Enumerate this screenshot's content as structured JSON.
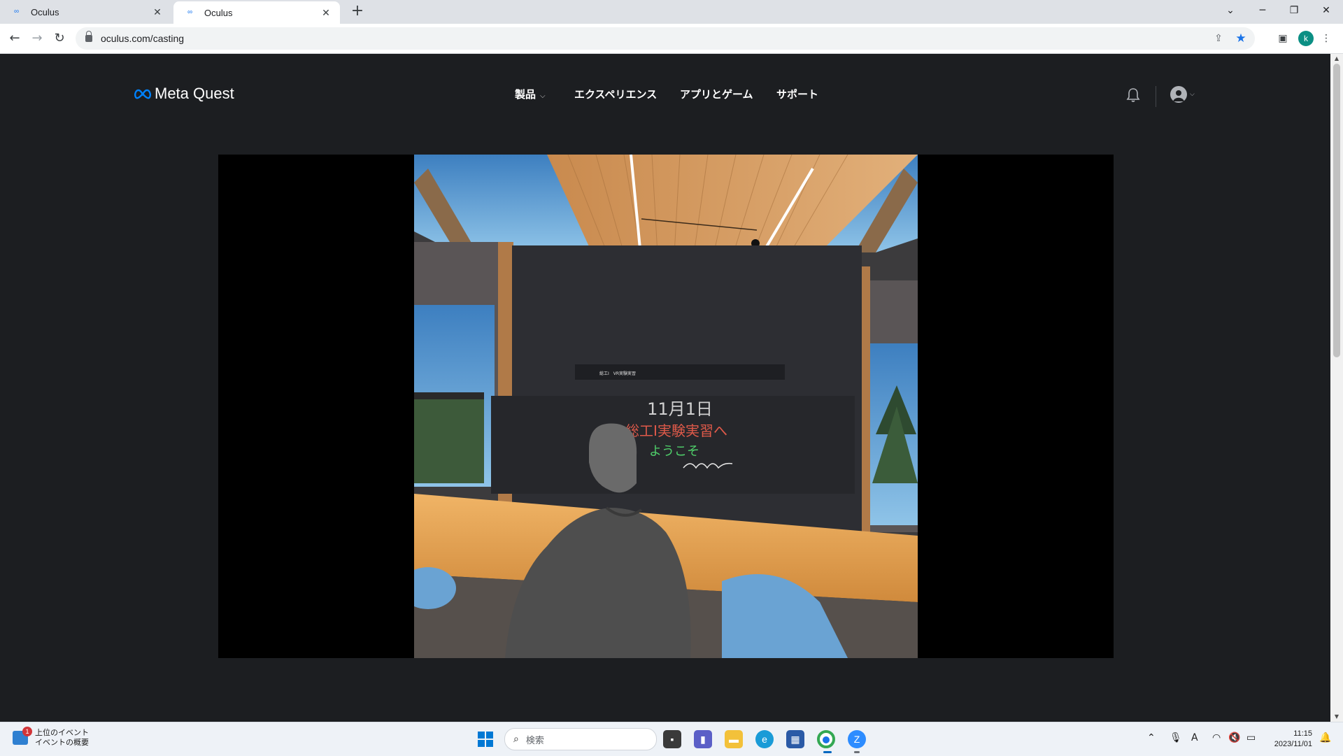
{
  "browser": {
    "tabs": [
      {
        "title": "Oculus",
        "favicon": "meta-icon",
        "active": false
      },
      {
        "title": "Oculus",
        "favicon": "meta-icon",
        "active": true
      }
    ],
    "new_tab": "+",
    "url": "oculus.com/casting",
    "profile_initial": "k"
  },
  "site": {
    "logo_text": "Meta Quest",
    "nav": [
      {
        "label": "製品",
        "has_dropdown": true
      },
      {
        "label": "エクスペリエンス",
        "has_dropdown": false
      },
      {
        "label": "アプリとゲーム",
        "has_dropdown": false
      },
      {
        "label": "サポート",
        "has_dropdown": false
      }
    ],
    "accent_color": "#0081fb",
    "page_bg": "#1c1e21"
  },
  "casting": {
    "board_title": "総工Ⅰ　VR実験実習",
    "board_lines": [
      "11月1日",
      "総工Ⅰ実験実習へ",
      "ようこそ"
    ]
  },
  "taskbar": {
    "widget_badge": "1",
    "widget_title": "上位のイベント",
    "widget_subtitle": "イベントの概要",
    "search_placeholder": "検索",
    "clock_time": "11:15",
    "clock_date": "2023/11/01",
    "ime_indicator": "A"
  }
}
